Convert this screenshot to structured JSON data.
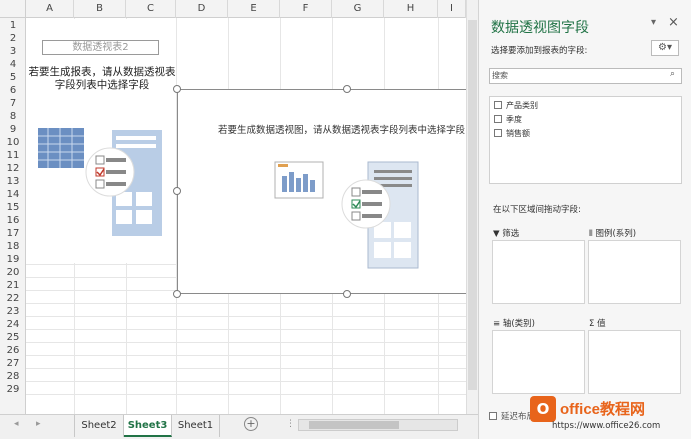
{
  "columns": [
    "A",
    "B",
    "C",
    "D",
    "E",
    "F",
    "G",
    "H",
    "I"
  ],
  "rows": [
    "1",
    "2",
    "3",
    "4",
    "5",
    "6",
    "7",
    "8",
    "9",
    "10",
    "11",
    "12",
    "13",
    "14",
    "15",
    "16",
    "17",
    "18",
    "19",
    "20",
    "21",
    "22",
    "23",
    "24",
    "25",
    "26",
    "27",
    "28",
    "29"
  ],
  "pivot": {
    "box_label": "数据透视表2",
    "message": "若要生成报表，请从数据透视表字段列表中选择字段"
  },
  "chart": {
    "message": "若要生成数据透视图，请从数据透视表字段列表中选择字段"
  },
  "tabs": {
    "items": [
      "Sheet2",
      "Sheet3",
      "Sheet1"
    ],
    "active": "Sheet3",
    "add_label": "+"
  },
  "panel": {
    "title": "数据透视图字段",
    "subtitle": "选择要添加到报表的字段:",
    "search_placeholder": "搜索",
    "fields": [
      "产品类别",
      "季度",
      "销售额"
    ],
    "areas_label": "在以下区域间拖动字段:",
    "zones": {
      "filter": "筛选",
      "legend": "图例(系列)",
      "axis": "轴(类别)",
      "values": "值"
    },
    "defer_label": "延迟布局更新"
  },
  "watermark": {
    "brand": "office教程网",
    "url": "https://www.office26.com"
  },
  "colors": {
    "accent": "#217346",
    "watermark_orange": "#e8641b"
  }
}
